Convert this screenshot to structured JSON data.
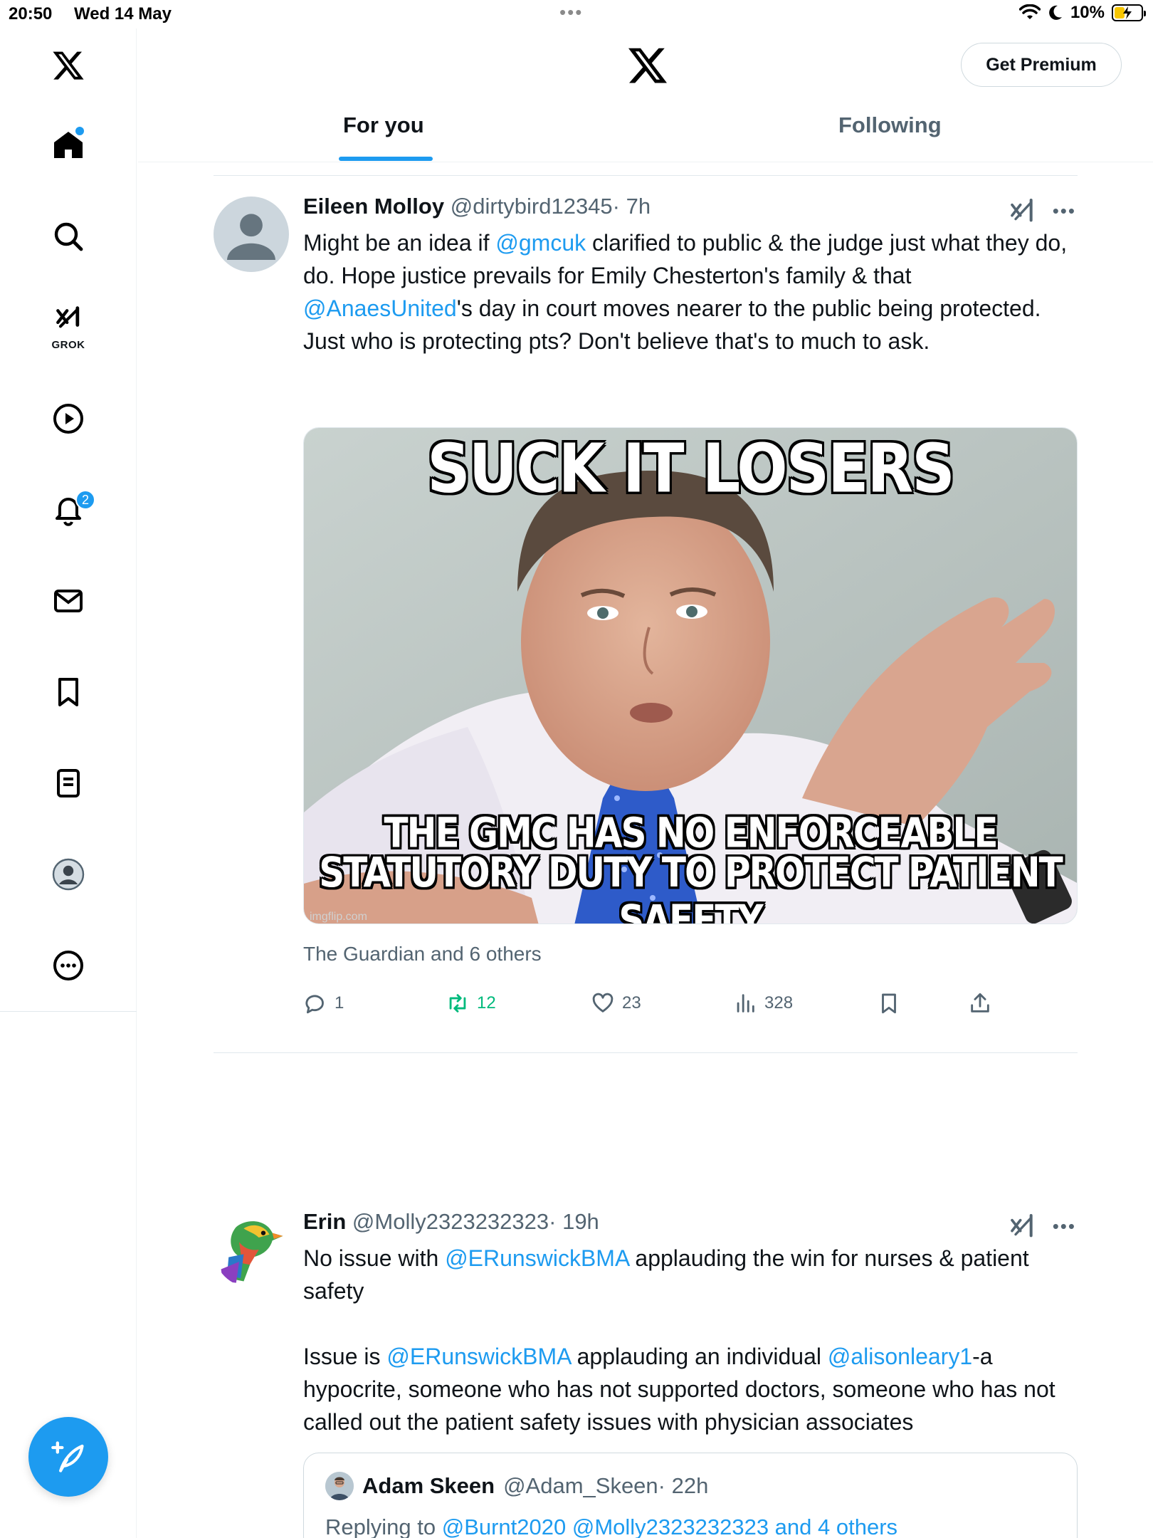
{
  "status_bar": {
    "time": "20:50",
    "date": "Wed 14 May",
    "battery": "10%"
  },
  "sidebar": {
    "grok_label": "GROK",
    "notifications_badge": "2"
  },
  "header": {
    "premium_label": "Get Premium",
    "tabs": [
      {
        "label": "For you",
        "active": true
      },
      {
        "label": "Following",
        "active": false
      }
    ]
  },
  "tweets": [
    {
      "name": "Eileen Molloy",
      "handle": "@dirtybird12345",
      "time": "· 7h",
      "body": {
        "t1": "Might be an idea if ",
        "m1": "@gmcuk",
        "t2": " clarified  to public & the judge just what they do, do. Hope justice prevails for Emily Chesterton's family & that ",
        "m2": "@AnaesUnited",
        "t3": "'s day in court moves nearer to the public being protected. Just who is protecting pts? Don't believe that's to much to ask."
      },
      "media": {
        "top_caption": "SUCK IT LOSERS",
        "bottom_caption_1": "THE GMC HAS NO ENFORCEABLE",
        "bottom_caption_2": "STATUTORY DUTY TO PROTECT PATIENT SAFETY",
        "watermark": "imgflip.com"
      },
      "source": "The Guardian and 6 others",
      "stats": {
        "replies": "1",
        "reposts": "12",
        "likes": "23",
        "views": "328"
      }
    },
    {
      "name": "Erin",
      "handle": "@Molly2323232323",
      "time": "· 19h",
      "body": {
        "p1_t1": "No issue with ",
        "p1_m1": "@ERunswickBMA",
        "p1_t2": " applauding the win for nurses & patient safety",
        "p2_t1": "Issue is ",
        "p2_m1": "@ERunswickBMA",
        "p2_t2": " applauding an individual ",
        "p2_m2": "@alisonleary1",
        "p2_t3": "-a hypocrite, someone who has not supported doctors, someone who has not called out the patient safety issues with physician associates"
      },
      "quote": {
        "name": "Adam Skeen",
        "handle": "@Adam_Skeen",
        "time": "· 22h",
        "replying_prefix": "Replying to ",
        "replying_to": "@Burnt2020 @Molly2323232323 and 4 others"
      }
    }
  ],
  "colors": {
    "accent": "#1d9bf0",
    "repost": "#00ba7c",
    "muted_text": "#536471",
    "primary_text": "#0f1419"
  },
  "icons": {
    "sidebar": [
      "x-logo-icon",
      "home-icon",
      "search-icon",
      "grok-icon",
      "video-icon",
      "bell-icon",
      "mail-icon",
      "bookmark-icon",
      "lists-icon",
      "profile-icon",
      "more-icon"
    ],
    "actions": [
      "reply-icon",
      "repost-icon",
      "like-icon",
      "views-icon",
      "bookmark-icon",
      "share-icon"
    ],
    "fab": "compose-icon"
  }
}
